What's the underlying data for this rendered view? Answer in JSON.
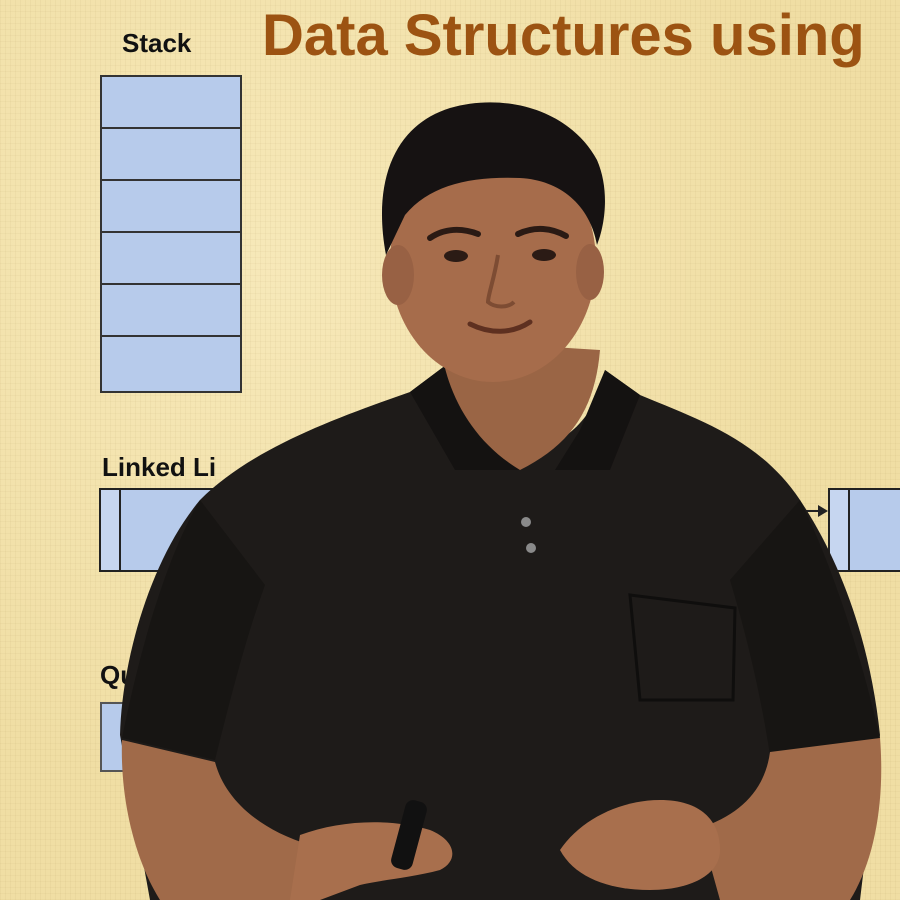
{
  "slide": {
    "title": "Data Structures using",
    "labels": {
      "stack": "Stack",
      "linked_list": "Linked Li",
      "queue": "Qu"
    },
    "stack_cells": 6,
    "colors": {
      "background": "#f0dea4",
      "title": "#9c5312",
      "cell_fill": "#b7cbeb",
      "outline": "#333333"
    }
  },
  "presenter": {
    "shirt_color": "#1e1b19",
    "holding": "marker"
  }
}
